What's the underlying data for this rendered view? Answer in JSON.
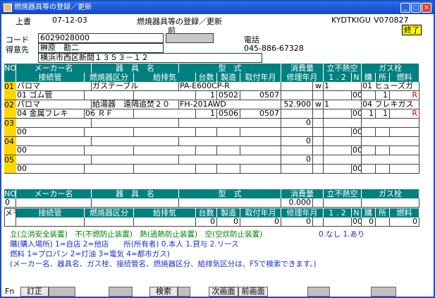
{
  "window": {
    "title": "燃焼器具等の登録／更新",
    "minimize": "_",
    "maximize": "□",
    "close": "×"
  },
  "header": {
    "mode": "上書",
    "date": "07-12-03",
    "screen_title": "燃焼器具等の登録／更新",
    "program_id": "KYDTKIGU",
    "version": "V070827",
    "exit_label": "終了",
    "prev_label": "前"
  },
  "customer": {
    "code_label": "コード",
    "code": "6029028000",
    "name_label": "得意先",
    "name": "榊原　勘二",
    "address": "横浜市西区新間１３５３－１２",
    "tel_label": "電話",
    "tel": "045-886-67328"
  },
  "grid_headers": {
    "row1": [
      "NO",
      "メーカー名",
      "器　具　名",
      "型　式",
      "消費量",
      "立不熱空",
      "ガス栓"
    ],
    "row2": [
      "接続管",
      "燃焼器区分",
      "給排気",
      "台数",
      "製造",
      "取付年月",
      "修理年月",
      "1 . 2",
      "N",
      "購",
      "所",
      "燃料"
    ]
  },
  "rows": [
    {
      "no": "01",
      "maker": "パロマ",
      "appliance": "ガステーブル",
      "model": "PA-E600CP-R",
      "consumption": "",
      "unit": "w",
      "safety": "1",
      "gascock": "01 ヒューズガ",
      "pipe": "01 ゴム管",
      "kubun": "",
      "kyuhaiki": "",
      "count": "1",
      "seizo": "0502",
      "toritsuke": "0507",
      "shuri": "",
      "amount": "00",
      "konyu": "",
      "shoyu": "1",
      "fuel": "R"
    },
    {
      "no": "02",
      "maker": "パロマ",
      "appliance": "給湯器　遠隔追焚２０",
      "model": "FH-201AWD",
      "consumption": "52.900",
      "unit": "w",
      "safety": "1",
      "gascock": "04 フレキガス",
      "pipe": "04 金属フレキ",
      "kubun": "06 ＲＦ",
      "kyuhaiki": "",
      "count": "1",
      "seizo": "0506",
      "toritsuke": "0507",
      "shuri": "",
      "amount": "00",
      "konyu": "1",
      "shoyu": "1",
      "fuel": "R"
    },
    {
      "no": "03",
      "maker": "",
      "appliance": "",
      "model": "",
      "consumption": "0",
      "unit": "",
      "safety": "",
      "gascock": "",
      "pipe": "00",
      "kubun": "",
      "kyuhaiki": "",
      "count": "",
      "seizo": "",
      "toritsuke": "",
      "shuri": "",
      "amount": "00",
      "konyu": "",
      "shoyu": "",
      "fuel": ""
    },
    {
      "no": "04",
      "maker": "",
      "appliance": "",
      "model": "",
      "consumption": "0",
      "unit": "",
      "safety": "",
      "gascock": "",
      "pipe": "00",
      "kubun": "",
      "kyuhaiki": "",
      "count": "",
      "seizo": "",
      "toritsuke": "",
      "shuri": "",
      "amount": "00",
      "konyu": "",
      "shoyu": "",
      "fuel": ""
    },
    {
      "no": "05",
      "maker": "",
      "appliance": "",
      "model": "",
      "consumption": "0",
      "unit": "",
      "safety": "",
      "gascock": "",
      "pipe": "00",
      "kubun": "",
      "kyuhaiki": "",
      "count": "",
      "seizo": "",
      "toritsuke": "",
      "shuri": "",
      "amount": "00",
      "konyu": "",
      "shoyu": "",
      "fuel": ""
    }
  ],
  "entry": {
    "no": "0",
    "consumption": "0.000",
    "memo_label": "メモ",
    "count": "0",
    "seizo": "0",
    "toritsuke": "0",
    "shuri": "0",
    "amount": "00",
    "n_val": "0",
    "fuel": "0"
  },
  "help": {
    "line1a": "立(立消安全装置)　不(不燃防止装置)　熱(過熱防止装置)　空(空炊防止装置)",
    "line1b": "0.なし 1.あり",
    "line2": "購(購入場所) 1=自店 2=他店　　所(所有者) 0.本人 1.貸与 2.リース",
    "line3": "燃料 1=プロパン 2=灯油 3=電気 4=都市ガス)",
    "line4": "(メーカー名、器具名、ガス栓、接続管名、燃焼器区分、給排気区分は、F5で検索できます。)"
  },
  "fkeys": {
    "fn": "Fn",
    "f1": "訂正",
    "f5": "検索",
    "f7": "次画面",
    "f8": "前画面"
  }
}
